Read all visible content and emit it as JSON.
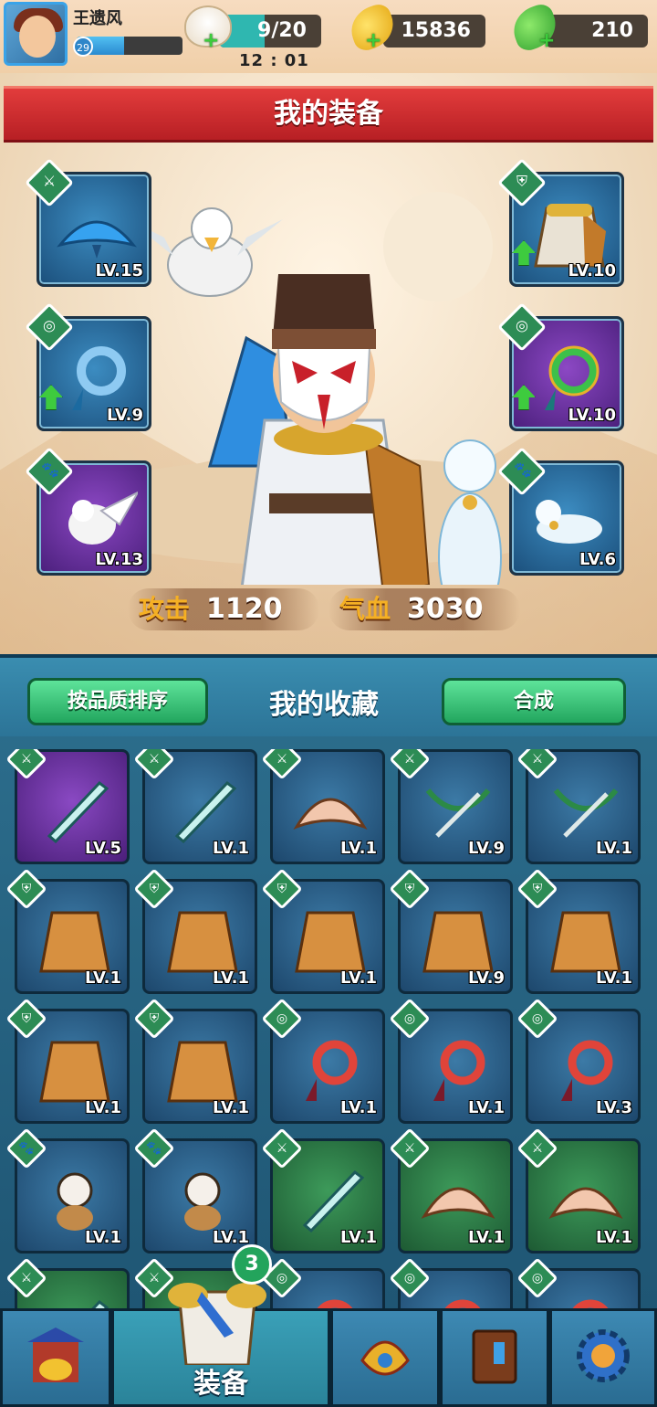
{
  "player": {
    "name": "王遗风",
    "level": "29",
    "xp_progress": 0.45
  },
  "resources": {
    "energy": {
      "value": "9/20",
      "progress": 0.45,
      "icon": "steamed-bun-icon"
    },
    "gold": {
      "value": "15836",
      "icon": "gold-leaf-icon"
    },
    "leaf": {
      "value": "210",
      "icon": "green-leaf-icon"
    }
  },
  "time": "12 : 01",
  "equipment": {
    "title": "我的装备",
    "slots": [
      {
        "name": "weapon-fan",
        "level": "LV.15",
        "type": "weapon",
        "icon": "fan-icon",
        "rarity": "blue"
      },
      {
        "name": "necklace",
        "level": "LV.9",
        "type": "accessory",
        "icon": "jade-pendant-icon",
        "rarity": "blue",
        "upgrade": true
      },
      {
        "name": "pet-owl",
        "level": "LV.13",
        "type": "pet",
        "icon": "owl-icon",
        "rarity": "purple"
      },
      {
        "name": "armor-robe",
        "level": "LV.10",
        "type": "armor",
        "icon": "robe-icon",
        "rarity": "blue",
        "upgrade": true
      },
      {
        "name": "jade-dragon",
        "level": "LV.10",
        "type": "accessory",
        "icon": "dragon-pendant-icon",
        "rarity": "purple",
        "upgrade": true
      },
      {
        "name": "pet-ferret",
        "level": "LV.6",
        "type": "pet",
        "icon": "ferret-icon",
        "rarity": "blue"
      }
    ],
    "stats": [
      {
        "label": "攻击",
        "value": "1120"
      },
      {
        "label": "气血",
        "value": "3030"
      }
    ]
  },
  "collection": {
    "title": "我的收藏",
    "sort_button": "按品质排序",
    "merge_button": "合成",
    "items": [
      {
        "icon": "red-sword-icon",
        "level": "LV.5",
        "rarity": "purple",
        "type": "weapon"
      },
      {
        "icon": "jade-sword-icon",
        "level": "LV.1",
        "rarity": "blue",
        "type": "weapon"
      },
      {
        "icon": "fan-icon",
        "level": "LV.1",
        "rarity": "blue",
        "type": "weapon"
      },
      {
        "icon": "crossbow-icon",
        "level": "LV.9",
        "rarity": "blue",
        "type": "weapon"
      },
      {
        "icon": "crossbow-icon",
        "level": "LV.1",
        "rarity": "blue",
        "type": "weapon"
      },
      {
        "icon": "orange-robe-icon",
        "level": "LV.1",
        "rarity": "blue",
        "type": "armor"
      },
      {
        "icon": "orange-robe-icon",
        "level": "LV.1",
        "rarity": "blue",
        "type": "armor"
      },
      {
        "icon": "blue-cloak-icon",
        "level": "LV.1",
        "rarity": "blue",
        "type": "armor"
      },
      {
        "icon": "blue-cloak-icon",
        "level": "LV.9",
        "rarity": "blue",
        "type": "armor"
      },
      {
        "icon": "white-robe-icon",
        "level": "LV.1",
        "rarity": "blue",
        "type": "armor"
      },
      {
        "icon": "green-robe-icon",
        "level": "LV.1",
        "rarity": "blue",
        "type": "armor"
      },
      {
        "icon": "green-robe-icon",
        "level": "LV.1",
        "rarity": "blue",
        "type": "armor"
      },
      {
        "icon": "jade-pendant-icon",
        "level": "LV.1",
        "rarity": "blue",
        "type": "accessory"
      },
      {
        "icon": "red-phoenix-pendant-icon",
        "level": "LV.1",
        "rarity": "blue",
        "type": "accessory"
      },
      {
        "icon": "gold-dragon-pendant-icon",
        "level": "LV.3",
        "rarity": "blue",
        "type": "accessory"
      },
      {
        "icon": "monkey-pet-icon",
        "level": "LV.1",
        "rarity": "blue",
        "type": "pet"
      },
      {
        "icon": "panda-pet-icon",
        "level": "LV.1",
        "rarity": "blue",
        "type": "pet"
      },
      {
        "icon": "blue-sword-icon",
        "level": "LV.1",
        "rarity": "green",
        "type": "weapon"
      },
      {
        "icon": "folding-fan-icon",
        "level": "LV.1",
        "rarity": "green",
        "type": "weapon"
      },
      {
        "icon": "folding-fan-icon",
        "level": "LV.1",
        "rarity": "green",
        "type": "weapon"
      },
      {
        "icon": "red-blade-icon",
        "level": "",
        "rarity": "green",
        "type": "weapon"
      },
      {
        "icon": "red-blade-icon",
        "level": "",
        "rarity": "green",
        "type": "weapon"
      },
      {
        "icon": "jade-pendant-icon",
        "level": "",
        "rarity": "blue",
        "type": "accessory"
      },
      {
        "icon": "red-phoenix-pendant-icon",
        "level": "",
        "rarity": "blue",
        "type": "accessory"
      },
      {
        "icon": "gold-dragon-pendant-icon",
        "level": "",
        "rarity": "blue",
        "type": "accessory"
      }
    ]
  },
  "nav": {
    "tabs": [
      {
        "name": "shop",
        "icon": "treasure-gate-icon",
        "label": ""
      },
      {
        "name": "equipment",
        "icon": "armor-icon",
        "label": "装备",
        "badge": "3",
        "active": true
      },
      {
        "name": "skills",
        "icon": "phoenix-mask-icon",
        "label": ""
      },
      {
        "name": "codex",
        "icon": "book-icon",
        "label": ""
      },
      {
        "name": "settings",
        "icon": "gear-icon",
        "label": ""
      }
    ]
  }
}
